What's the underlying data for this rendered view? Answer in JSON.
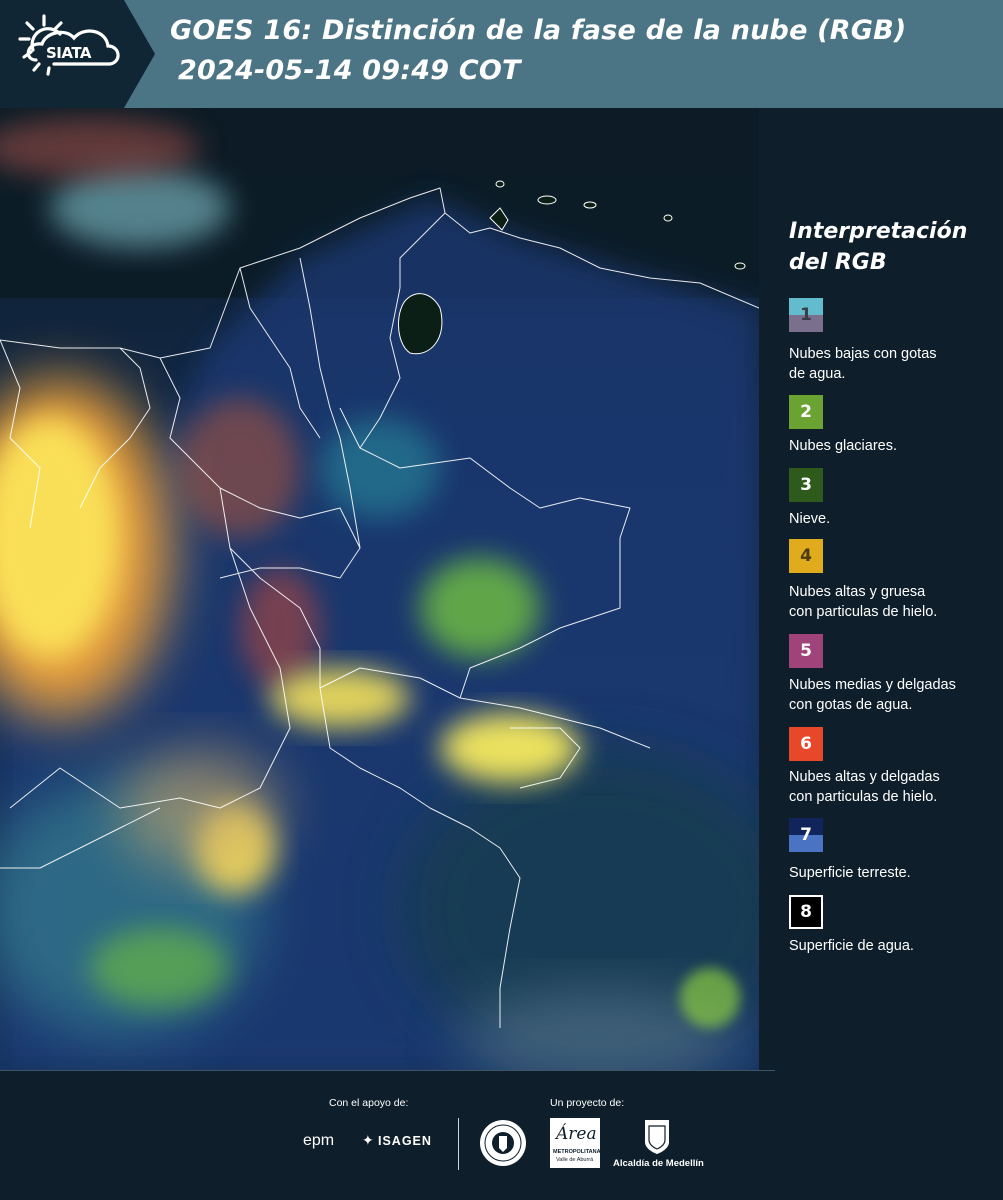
{
  "header": {
    "logo_text": "SIATA",
    "title": "GOES 16: Distinción de la fase de la nube (RGB)",
    "timestamp": "2024-05-14 09:49 COT"
  },
  "legend": {
    "title_line1": "Interpretación",
    "title_line2": "del RGB",
    "items": [
      {
        "number": "1",
        "label_line1": "Nubes bajas con gotas",
        "label_line2": "de agua.",
        "color_top": "#62bccd",
        "color_bottom": "#7a6f8c"
      },
      {
        "number": "2",
        "label_line1": "Nubes glaciares.",
        "label_line2": "",
        "color": "#6aa331"
      },
      {
        "number": "3",
        "label_line1": "Nieve.",
        "label_line2": "",
        "color": "#2e5a1c"
      },
      {
        "number": "4",
        "label_line1": "Nubes altas y gruesa",
        "label_line2": "con particulas de hielo.",
        "color": "#e0ab1c"
      },
      {
        "number": "5",
        "label_line1": "Nubes medias y delgadas",
        "label_line2": "con gotas de agua.",
        "color": "#a0437a"
      },
      {
        "number": "6",
        "label_line1": "Nubes altas y delgadas",
        "label_line2": "con particulas de hielo.",
        "color": "#e8482a"
      },
      {
        "number": "7",
        "label_line1": "Superficie terreste.",
        "label_line2": "",
        "color_top": "#12245c",
        "color_bottom": "#4a73c4"
      },
      {
        "number": "8",
        "label_line1": "Superficie de agua.",
        "label_line2": "",
        "color": "#000000"
      }
    ]
  },
  "footer": {
    "support_caption": "Con el apoyo de:",
    "project_caption": "Un proyecto de:",
    "sponsor1": "epm",
    "sponsor2": "ISAGEN",
    "area_logo_text": "Área",
    "area_sub1": "METROPOLITANA",
    "area_sub2": "Valle de Aburrá",
    "alcaldia": "Alcaldía de Medellín"
  }
}
